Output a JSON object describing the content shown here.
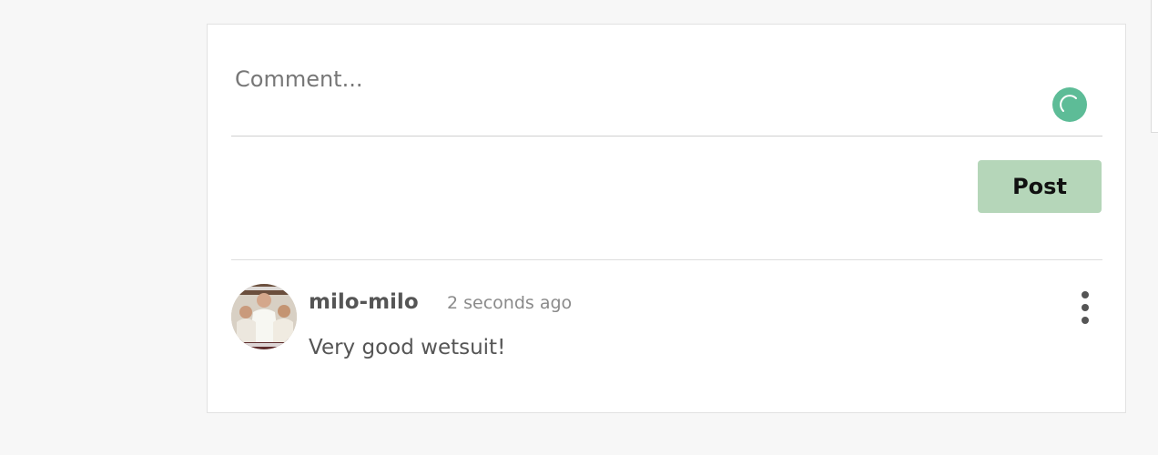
{
  "comment_box": {
    "placeholder": "Comment...",
    "value": "",
    "loading_icon": "loading-spinner-icon",
    "accent_color": "#5dbc97"
  },
  "actions": {
    "post_label": "Post",
    "post_color": "#b5d6b9"
  },
  "comments": [
    {
      "username": "milo-milo",
      "timestamp": "2 seconds ago",
      "text": "Very good wetsuit!",
      "more_icon": "vertical-ellipsis-icon"
    }
  ]
}
